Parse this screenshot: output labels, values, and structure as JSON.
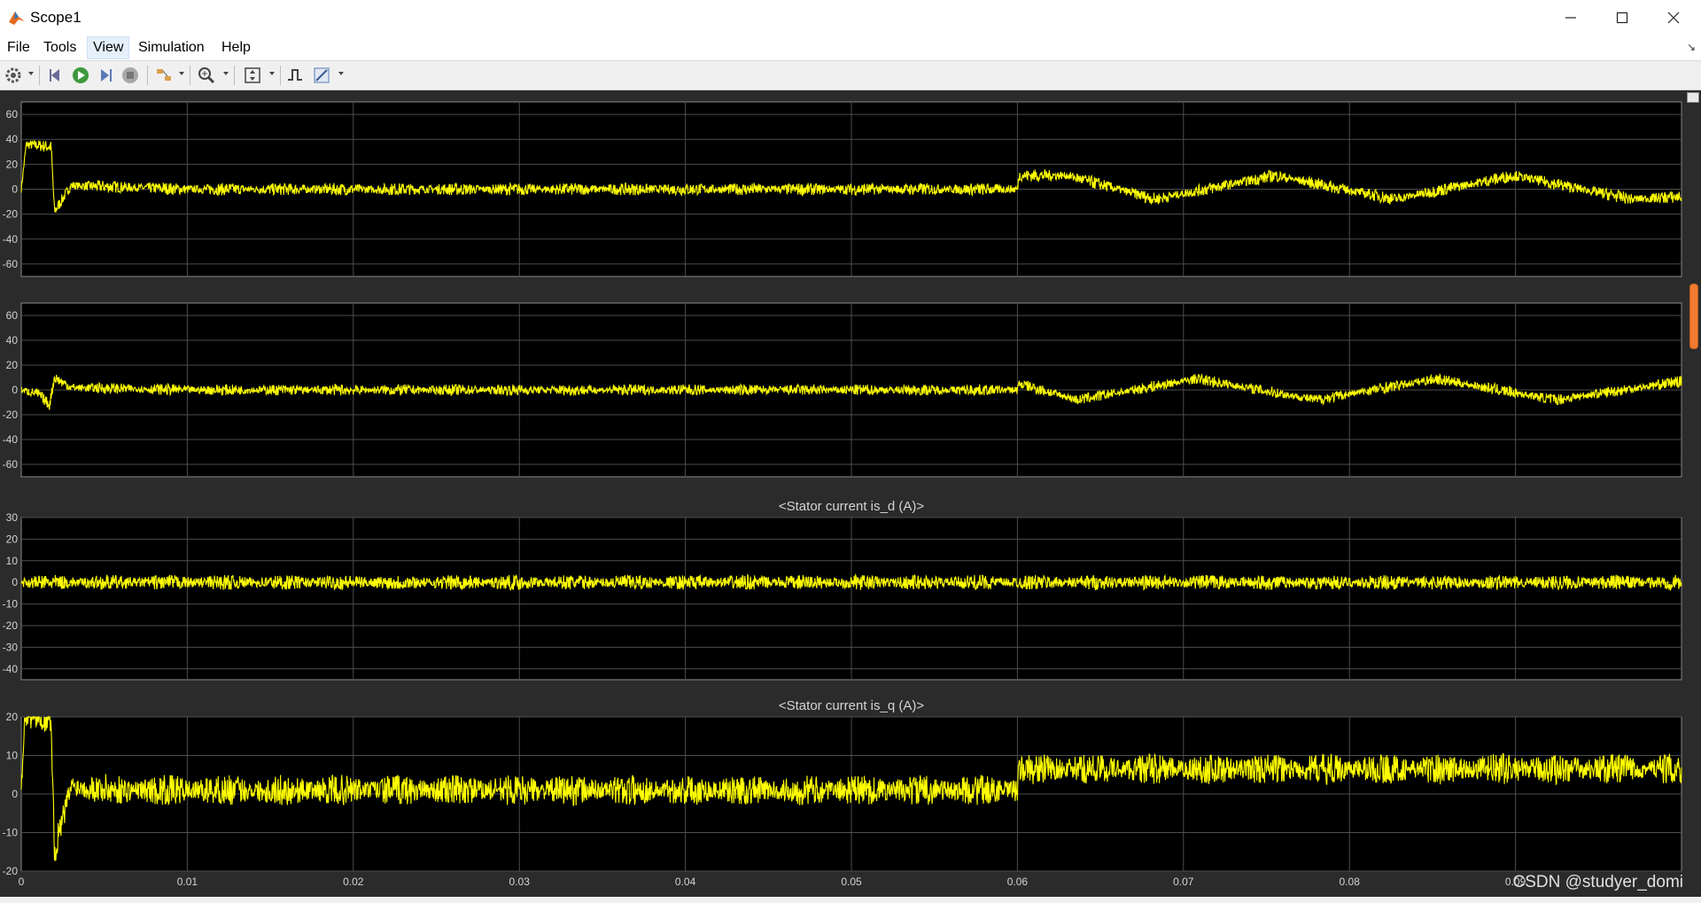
{
  "window": {
    "title": "Scope1",
    "icon": "matlab-icon",
    "controls": [
      "minimize-icon",
      "maximize-icon",
      "close-icon"
    ]
  },
  "menu": {
    "items": [
      {
        "label": "File",
        "name": "menu-file"
      },
      {
        "label": "Tools",
        "name": "menu-tools"
      },
      {
        "label": "View",
        "name": "menu-view",
        "active": true
      },
      {
        "label": "Simulation",
        "name": "menu-simulation"
      },
      {
        "label": "Help",
        "name": "menu-help"
      }
    ],
    "collapse_icon": "undock-arrow-icon"
  },
  "toolbar": {
    "buttons": [
      "settings-icon",
      "step-back-icon",
      "run-icon",
      "step-forward-icon",
      "stop-icon",
      "highlight-simulink-icon",
      "zoom-in-icon",
      "autoscale-icon",
      "trigger-icon",
      "measurements-icon"
    ]
  },
  "colors": {
    "plot_bg": "#000000",
    "trace": "#ffff00",
    "grid": "#4d4d4d",
    "axis_text": "#d4d4d4",
    "frame_bg": "#2b2b2b",
    "scroll_thumb": "#f07b2e"
  },
  "watermark": "CSDN @studyer_domi",
  "chart_data": [
    {
      "type": "line",
      "title": "",
      "xlim": [
        0,
        0.1
      ],
      "ylim": [
        -70,
        70
      ],
      "yticks": [
        60,
        40,
        20,
        0,
        -20,
        -40,
        -60
      ],
      "grid": true,
      "series": [
        {
          "values": [
            [
              0.0,
              0
            ],
            [
              0.0003,
              36
            ],
            [
              0.0018,
              34
            ],
            [
              0.002,
              -18
            ],
            [
              0.003,
              3
            ],
            [
              0.01,
              0
            ],
            [
              0.06,
              0
            ],
            [
              0.0601,
              11
            ],
            [
              0.063,
              11
            ],
            [
              0.0683,
              -8
            ],
            [
              0.0755,
              11
            ],
            [
              0.0827,
              -8
            ],
            [
              0.0899,
              11
            ],
            [
              0.097,
              -8
            ],
            [
              0.1,
              -6
            ]
          ],
          "noise": 5
        }
      ]
    },
    {
      "type": "line",
      "title": "",
      "xlim": [
        0,
        0.1
      ],
      "ylim": [
        -70,
        70
      ],
      "yticks": [
        60,
        40,
        20,
        0,
        -20,
        -40,
        -60
      ],
      "grid": true,
      "series": [
        {
          "values": [
            [
              0.0,
              0
            ],
            [
              0.001,
              -3
            ],
            [
              0.0017,
              -12
            ],
            [
              0.002,
              10
            ],
            [
              0.003,
              2
            ],
            [
              0.01,
              0
            ],
            [
              0.06,
              0
            ],
            [
              0.0601,
              5
            ],
            [
              0.0636,
              -8
            ],
            [
              0.0708,
              9
            ],
            [
              0.078,
              -8
            ],
            [
              0.0852,
              9
            ],
            [
              0.0924,
              -8
            ],
            [
              0.1,
              7
            ]
          ],
          "noise": 4.5
        }
      ]
    },
    {
      "type": "line",
      "title": "<Stator current is_d (A)>",
      "xlim": [
        0,
        0.1
      ],
      "ylim": [
        -45,
        30
      ],
      "yticks": [
        30,
        20,
        10,
        0,
        -10,
        -20,
        -30,
        -40
      ],
      "grid": true,
      "series": [
        {
          "values": [
            [
              0.0,
              0
            ],
            [
              0.1,
              0
            ]
          ],
          "noise": 3.5
        }
      ]
    },
    {
      "type": "line",
      "title": "<Stator current is_q (A)>",
      "xlim": [
        0,
        0.1
      ],
      "ylim": [
        -20,
        20
      ],
      "yticks": [
        20,
        10,
        0,
        -10,
        -20
      ],
      "xticks": [
        0,
        0.01,
        0.02,
        0.03,
        0.04,
        0.05,
        0.06,
        0.07,
        0.08,
        0.09
      ],
      "xtick_labels": [
        "0",
        "0.01",
        "0.02",
        "0.03",
        "0.04",
        "0.05",
        "0.06",
        "0.07",
        "0.08",
        "0.09"
      ],
      "grid": true,
      "series": [
        {
          "values": [
            [
              0.0,
              0
            ],
            [
              0.0002,
              20
            ],
            [
              0.0018,
              20
            ],
            [
              0.002,
              -15
            ],
            [
              0.003,
              2
            ],
            [
              0.006,
              1
            ],
            [
              0.06,
              1
            ],
            [
              0.0601,
              6.5
            ],
            [
              0.1,
              6.5
            ]
          ],
          "noise": 4
        }
      ]
    }
  ]
}
